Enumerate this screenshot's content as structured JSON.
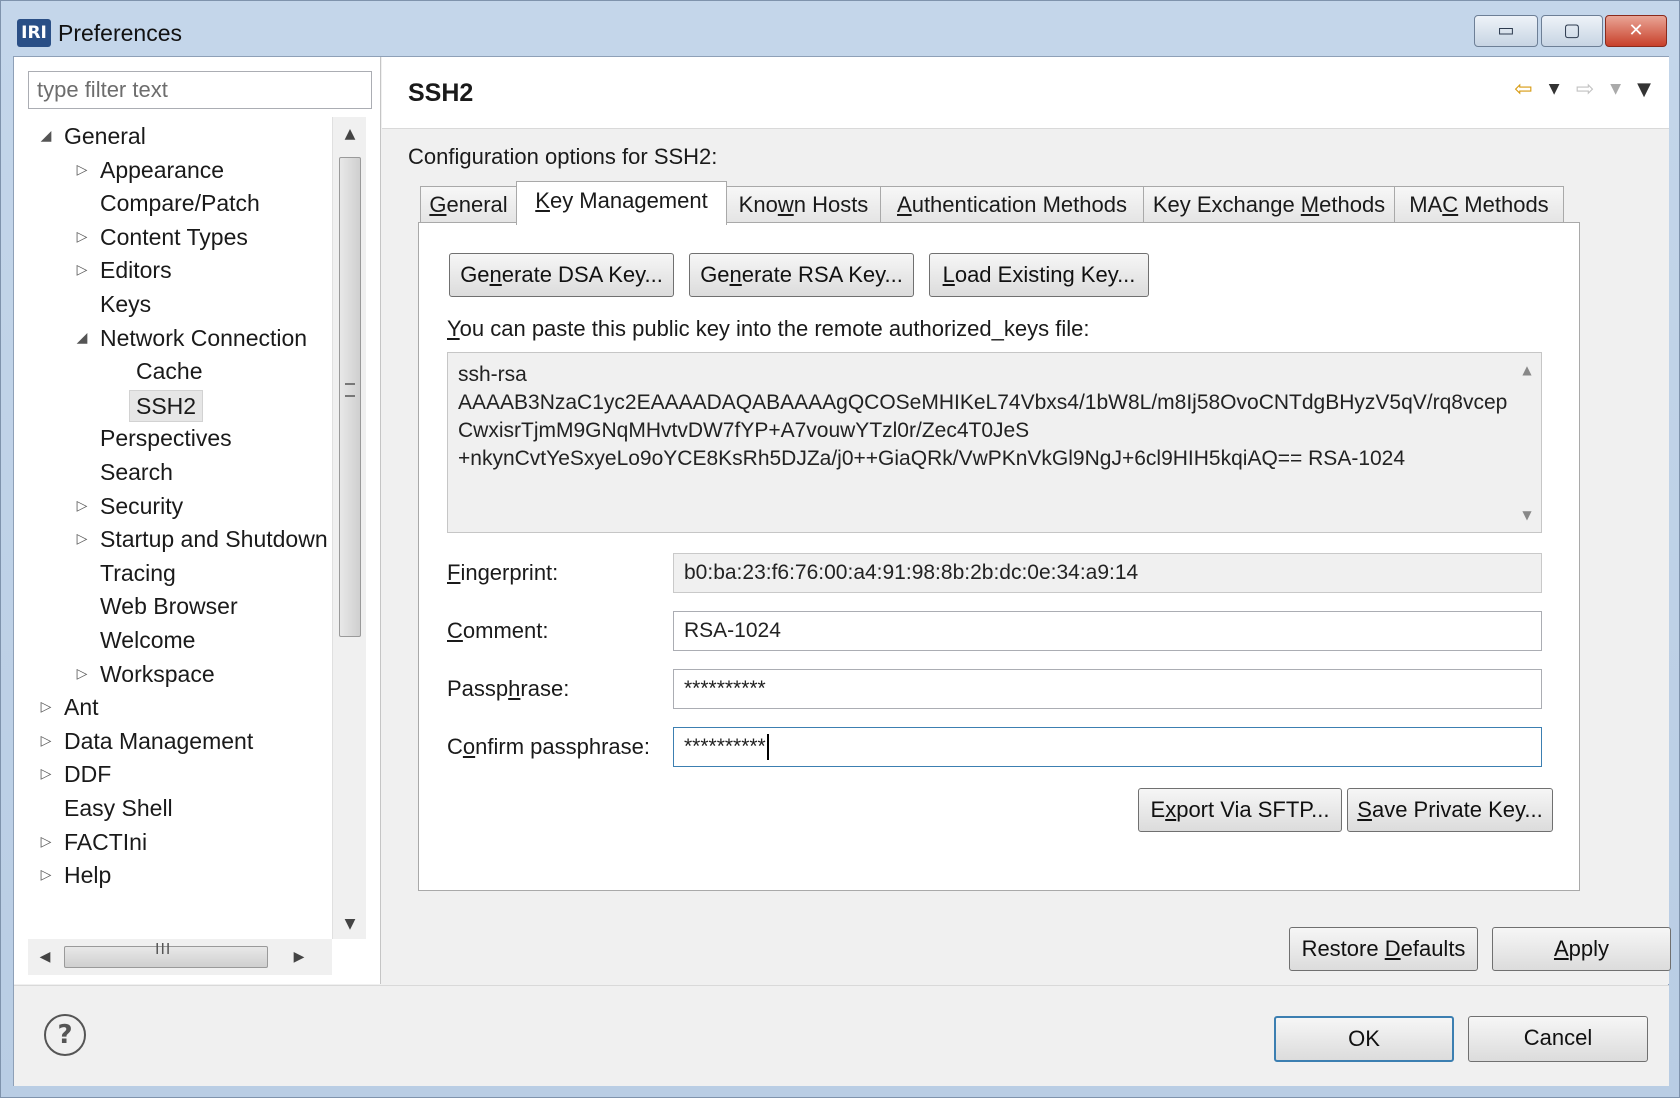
{
  "window": {
    "title": "Preferences",
    "logo_text": "IRI",
    "controls": {
      "minimize": "▭",
      "maximize": "▢",
      "close": "✕"
    }
  },
  "sidebar": {
    "filter_placeholder": "type filter text",
    "tree": [
      {
        "label": "General",
        "level": 0,
        "twisty": "expanded"
      },
      {
        "label": "Appearance",
        "level": 1,
        "twisty": "collapsed"
      },
      {
        "label": "Compare/Patch",
        "level": 1,
        "twisty": "none"
      },
      {
        "label": "Content Types",
        "level": 1,
        "twisty": "collapsed"
      },
      {
        "label": "Editors",
        "level": 1,
        "twisty": "collapsed"
      },
      {
        "label": "Keys",
        "level": 1,
        "twisty": "none"
      },
      {
        "label": "Network Connection",
        "level": 1,
        "twisty": "expanded"
      },
      {
        "label": "Cache",
        "level": 2,
        "twisty": "none"
      },
      {
        "label": "SSH2",
        "level": 2,
        "twisty": "none",
        "selected": true
      },
      {
        "label": "Perspectives",
        "level": 1,
        "twisty": "none"
      },
      {
        "label": "Search",
        "level": 1,
        "twisty": "none"
      },
      {
        "label": "Security",
        "level": 1,
        "twisty": "collapsed"
      },
      {
        "label": "Startup and Shutdown",
        "level": 1,
        "twisty": "collapsed"
      },
      {
        "label": "Tracing",
        "level": 1,
        "twisty": "none"
      },
      {
        "label": "Web Browser",
        "level": 1,
        "twisty": "none"
      },
      {
        "label": "Welcome",
        "level": 1,
        "twisty": "none"
      },
      {
        "label": "Workspace",
        "level": 1,
        "twisty": "collapsed"
      },
      {
        "label": "Ant",
        "level": 0,
        "twisty": "collapsed"
      },
      {
        "label": "Data Management",
        "level": 0,
        "twisty": "collapsed"
      },
      {
        "label": "DDF",
        "level": 0,
        "twisty": "collapsed"
      },
      {
        "label": "Easy Shell",
        "level": 0,
        "twisty": "none"
      },
      {
        "label": "FACTIni",
        "level": 0,
        "twisty": "collapsed"
      },
      {
        "label": "Help",
        "level": 0,
        "twisty": "collapsed"
      }
    ],
    "hscroll_grip": "III"
  },
  "page": {
    "title": "SSH2",
    "description": "Configuration options for SSH2:",
    "tabs": [
      {
        "pre": "",
        "u": "G",
        "post": "eneral"
      },
      {
        "pre": "",
        "u": "K",
        "post": "ey Management",
        "active": true
      },
      {
        "pre": "Kno",
        "u": "w",
        "post": "n Hosts"
      },
      {
        "pre": "",
        "u": "A",
        "post": "uthentication Methods"
      },
      {
        "pre": "Key Exchange ",
        "u": "M",
        "post": "ethods"
      },
      {
        "pre": "MA",
        "u": "C",
        "post": " Methods"
      }
    ],
    "key_buttons": [
      {
        "pre": "Ge",
        "u": "n",
        "post": "erate DSA Key..."
      },
      {
        "pre": "Ge",
        "u": "n",
        "post": "erate RSA Key..."
      },
      {
        "pre": "",
        "u": "L",
        "post": "oad Existing Key..."
      }
    ],
    "paste_label": {
      "pre": "",
      "u": "Y",
      "post": "ou can paste this public key into the remote authorized_keys file:"
    },
    "public_key": "ssh-rsa\nAAAAB3NzaC1yc2EAAAADAQABAAAAgQCOSeMHIKeL74Vbxs4/1bW8L/m8Ij58OvoCNTdgBHyzV5qV/rq8vcepCwxisrTjmM9GNqMHvtvDW7fYP+A7vouwYTzl0r/Zec4T0JeS\n+nkynCvtYeSxyeLo9oYCE8KsRh5DJZa/j0++GiaQRk/VwPKnVkGl9NgJ+6cl9HIH5kqiAQ== RSA-1024",
    "fields": {
      "fingerprint": {
        "pre": "",
        "u": "F",
        "post": "ingerprint:",
        "value": "b0:ba:23:f6:76:00:a4:91:98:8b:2b:dc:0e:34:a9:14"
      },
      "comment": {
        "pre": "",
        "u": "C",
        "post": "omment:",
        "value": "RSA-1024"
      },
      "passphrase": {
        "pre": "Passp",
        "u": "h",
        "post": "rase:",
        "value": "**********"
      },
      "confirm": {
        "pre": "C",
        "u": "o",
        "post": "nfirm passphrase:",
        "value": "**********"
      }
    },
    "export_buttons": [
      {
        "pre": "E",
        "u": "x",
        "post": "port Via SFTP..."
      },
      {
        "pre": "",
        "u": "S",
        "post": "ave Private Key..."
      }
    ],
    "restore_defaults": {
      "pre": "Restore ",
      "u": "D",
      "post": "efaults"
    },
    "apply": {
      "pre": "",
      "u": "A",
      "post": "pply"
    }
  },
  "footer": {
    "ok": "OK",
    "cancel": "Cancel",
    "help_glyph": "?"
  },
  "icons": {
    "back": "⇦",
    "forward": "⇨",
    "dropdown": "▼",
    "tree_expanded": "◢",
    "tree_collapsed": "▷",
    "scroll_up": "▲",
    "scroll_down": "▼",
    "scroll_left": "◀",
    "scroll_right": "▶",
    "scroll_grip": "≡"
  }
}
